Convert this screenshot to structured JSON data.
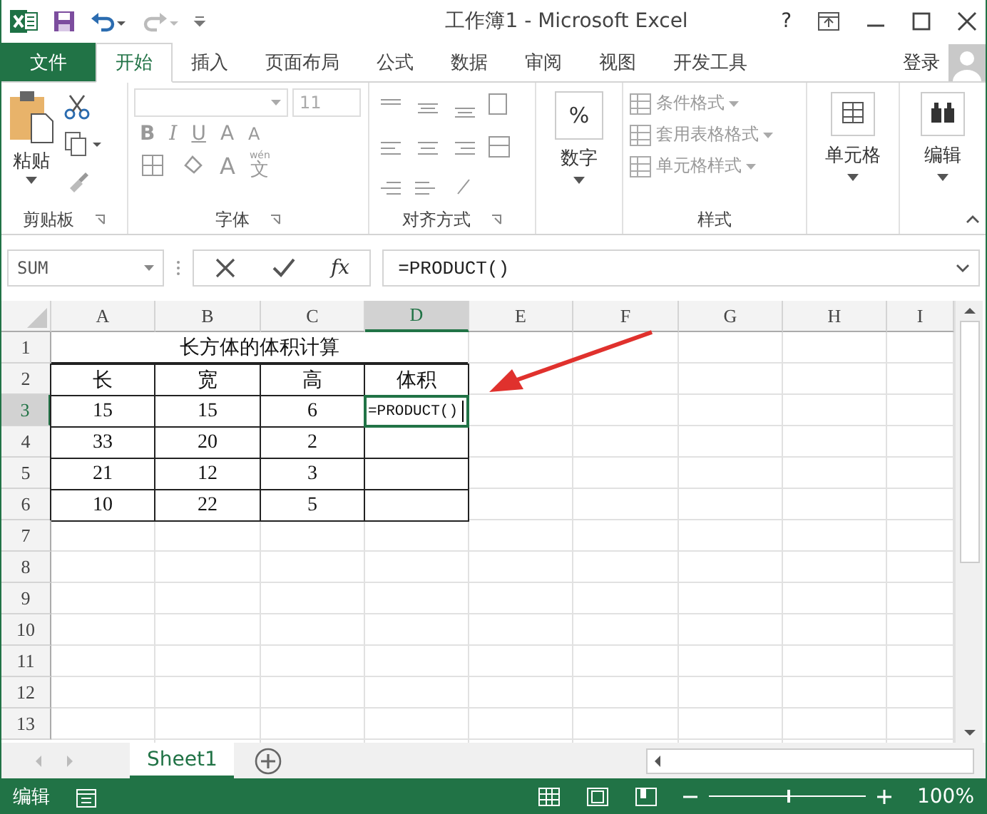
{
  "window": {
    "title": "工作簿1 - Microsoft Excel",
    "help": "?"
  },
  "tabs": [
    {
      "label": "文件",
      "kind": "file",
      "selected": false
    },
    {
      "label": "开始",
      "kind": "tab",
      "selected": true
    },
    {
      "label": "插入",
      "kind": "tab",
      "selected": false
    },
    {
      "label": "页面布局",
      "kind": "tab",
      "selected": false
    },
    {
      "label": "公式",
      "kind": "tab",
      "selected": false
    },
    {
      "label": "数据",
      "kind": "tab",
      "selected": false
    },
    {
      "label": "审阅",
      "kind": "tab",
      "selected": false
    },
    {
      "label": "视图",
      "kind": "tab",
      "selected": false
    },
    {
      "label": "开发工具",
      "kind": "tab",
      "selected": false
    }
  ],
  "account": {
    "label": "登录"
  },
  "ribbon": {
    "clipboard": {
      "paste": "粘贴",
      "label": "剪贴板"
    },
    "font": {
      "size": "11",
      "bold": "B",
      "italic": "I",
      "underline": "U",
      "grow": "A",
      "shrink": "A",
      "font_color": "A",
      "phonetic_top": "wén",
      "phonetic": "文",
      "label": "字体"
    },
    "alignment": {
      "label": "对齐方式"
    },
    "number": {
      "symbol": "%",
      "label": "数字"
    },
    "styles": {
      "items": [
        "条件格式",
        "套用表格格式",
        "单元格样式"
      ],
      "label": "样式"
    },
    "cells": {
      "label": "单元格"
    },
    "editing": {
      "label": "编辑"
    }
  },
  "formula_bar": {
    "name_box": "SUM",
    "fx": "fx",
    "formula": "=PRODUCT()"
  },
  "sheet": {
    "columns": [
      {
        "label": "A",
        "selected": false
      },
      {
        "label": "B",
        "selected": false
      },
      {
        "label": "C",
        "selected": false
      },
      {
        "label": "D",
        "selected": true
      },
      {
        "label": "E",
        "selected": false
      },
      {
        "label": "F",
        "selected": false
      },
      {
        "label": "G",
        "selected": false
      },
      {
        "label": "H",
        "selected": false
      },
      {
        "label": "I",
        "selected": false
      }
    ],
    "rows": [
      {
        "label": "1",
        "selected": false,
        "merged_title": "长方体的体积计算"
      },
      {
        "label": "2",
        "selected": false,
        "cells": [
          {
            "text": "长",
            "editing": false
          },
          {
            "text": "宽",
            "editing": false
          },
          {
            "text": "高",
            "editing": false
          },
          {
            "text": "体积",
            "editing": false
          }
        ]
      },
      {
        "label": "3",
        "selected": true,
        "cells": [
          {
            "text": "15",
            "editing": false
          },
          {
            "text": "15",
            "editing": false
          },
          {
            "text": "6",
            "editing": false
          },
          {
            "text": "=PRODUCT()",
            "editing": true
          }
        ]
      },
      {
        "label": "4",
        "selected": false,
        "cells": [
          {
            "text": "33",
            "editing": false
          },
          {
            "text": "20",
            "editing": false
          },
          {
            "text": "2",
            "editing": false
          },
          {
            "text": "",
            "editing": false
          }
        ]
      },
      {
        "label": "5",
        "selected": false,
        "cells": [
          {
            "text": "21",
            "editing": false
          },
          {
            "text": "12",
            "editing": false
          },
          {
            "text": "3",
            "editing": false
          },
          {
            "text": "",
            "editing": false
          }
        ]
      },
      {
        "label": "6",
        "selected": false,
        "cells": [
          {
            "text": "10",
            "editing": false
          },
          {
            "text": "22",
            "editing": false
          },
          {
            "text": "5",
            "editing": false
          },
          {
            "text": "",
            "editing": false
          }
        ]
      },
      {
        "label": "7",
        "selected": false
      },
      {
        "label": "8",
        "selected": false
      },
      {
        "label": "9",
        "selected": false
      },
      {
        "label": "10",
        "selected": false
      },
      {
        "label": "11",
        "selected": false
      },
      {
        "label": "12",
        "selected": false
      },
      {
        "label": "13",
        "selected": false
      }
    ]
  },
  "sheet_tabs": [
    {
      "label": "Sheet1",
      "selected": true
    }
  ],
  "status_bar": {
    "mode": "编辑",
    "zoom": "100%",
    "zoom_slider": {
      "level": 0.5
    }
  }
}
